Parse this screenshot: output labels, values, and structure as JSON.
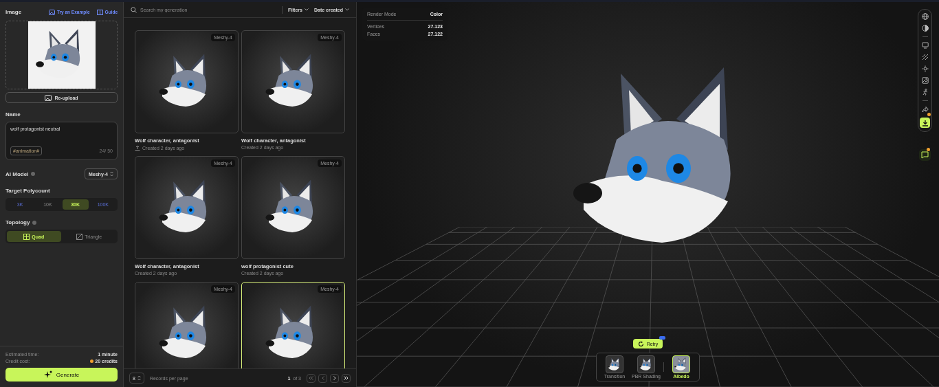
{
  "sidebar": {
    "image_label": "Image",
    "links": [
      {
        "kind": "example",
        "label": "Try an Example"
      },
      {
        "kind": "guide",
        "label": "Guide"
      }
    ],
    "reupload": "Re-upload",
    "name_label": "Name",
    "name_value": "wolf protagonist neutral",
    "tag": "#animation#",
    "char_count": "24/ 50",
    "model_label": "AI Model",
    "model_value": "Meshy-4",
    "polycount_label": "Target Polycount",
    "polycounts": [
      {
        "label": "3K",
        "selected": false
      },
      {
        "label": "10K",
        "selected": false
      },
      {
        "label": "30K",
        "selected": true
      },
      {
        "label": "100K",
        "selected": false
      }
    ],
    "topology_label": "Topology",
    "topologies": [
      {
        "kind": "quad",
        "label": "Quad",
        "selected": true
      },
      {
        "kind": "triangle",
        "label": "Triangle",
        "selected": false
      }
    ],
    "estimates": [
      {
        "kind": "time",
        "label": "Estimated time:",
        "value": "1 minute"
      },
      {
        "kind": "credits",
        "label": "Credit cost:",
        "value": "20 credits"
      }
    ],
    "generate": "Generate"
  },
  "gallery": {
    "search_placeholder": "Search my generation",
    "filters": "Filters",
    "sort": "Date created",
    "cards": [
      {
        "badge": "Meshy-4",
        "title": "Wolf character, antagonist",
        "meta": "Created 2 days ago",
        "uploaded": true,
        "selected": false
      },
      {
        "badge": "Meshy-4",
        "title": "Wolf character, antagonist",
        "meta": "Created 2 days ago",
        "uploaded": false,
        "selected": false
      },
      {
        "badge": "Meshy-4",
        "title": "Wolf character, antagonist",
        "meta": "Created 2 days ago",
        "uploaded": false,
        "selected": false
      },
      {
        "badge": "Meshy-4",
        "title": "wolf protagonist cute",
        "meta": "Created 2 days ago",
        "uploaded": false,
        "selected": false
      },
      {
        "badge": "Meshy-4",
        "selected": false
      },
      {
        "badge": "Meshy-4",
        "selected": true
      }
    ],
    "pagination": {
      "per_page": "8",
      "per_page_label": "Records per page",
      "page": "1",
      "total": "of 3"
    }
  },
  "viewer": {
    "stats": [
      {
        "label": "Render Mode",
        "value": "Color"
      },
      {
        "label": "Vertices",
        "value": "27.123"
      },
      {
        "label": "Faces",
        "value": "27.122"
      }
    ],
    "retry": "Retry",
    "textures": [
      {
        "label": "Transition",
        "selected": false
      },
      {
        "label": "PBR Shading",
        "selected": false
      },
      {
        "label": "Albedo",
        "selected": true
      }
    ]
  }
}
